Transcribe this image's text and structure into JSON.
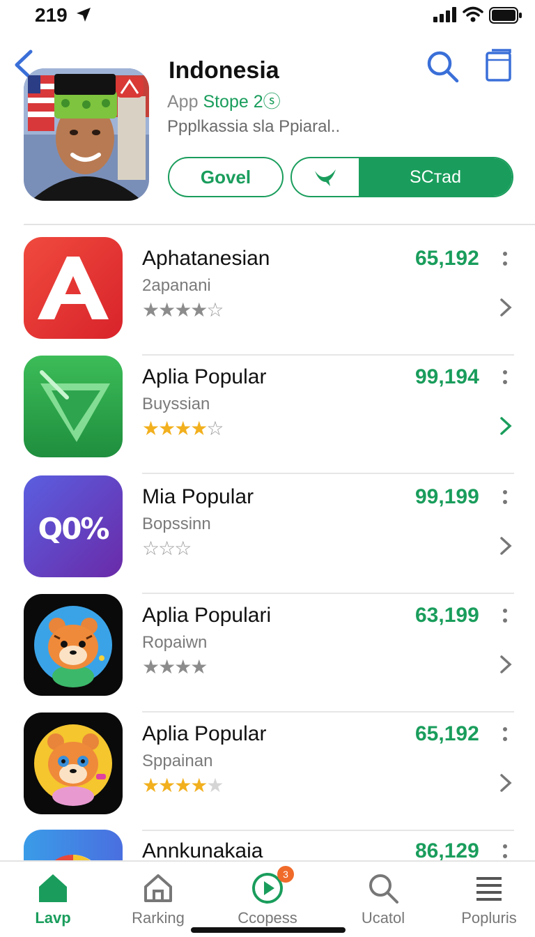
{
  "status_bar": {
    "time": "219"
  },
  "header": {
    "title": "Indonesia",
    "subtitle_prefix": "App ",
    "subtitle_accent": "Stope 2",
    "subtitle_suffix": "ⓢ",
    "description": "Ppplkassia sla Ppiaral..",
    "btn_outline_label": "Govel",
    "btn_action_label": "SCтad"
  },
  "apps": [
    {
      "name": "Aphatanesian",
      "category": "2apanani",
      "count": "65,192",
      "stars": "gray4",
      "icon": "letter-a"
    },
    {
      "name": "Aplia Popular",
      "category": "Buyssian",
      "count": "99,194",
      "stars": "gold3h",
      "icon": "green-arrow"
    },
    {
      "name": "Mia Popular",
      "category": "Bopssinn",
      "count": "99,199",
      "stars": "outline3",
      "icon": "percent",
      "icon_text": "Q0%"
    },
    {
      "name": "Aplia Populari",
      "category": "Ropaiwn",
      "count": "63,199",
      "stars": "gray4solid",
      "icon": "tiger-blue"
    },
    {
      "name": "Aplia Popular",
      "category": "Sppainan",
      "count": "65,192",
      "stars": "gold4",
      "icon": "tiger-yellow"
    },
    {
      "name": "Annkunakaia",
      "category": "",
      "count": "86,129",
      "stars": "",
      "icon": "chart-circle"
    }
  ],
  "tabs": [
    {
      "label": "Lavp",
      "icon": "home-icon",
      "active": true
    },
    {
      "label": "Rarking",
      "icon": "home-outline-icon",
      "active": false
    },
    {
      "label": "Ccopess",
      "icon": "play-circle-icon",
      "active": false,
      "badge": "3"
    },
    {
      "label": "Ucatol",
      "icon": "search-icon",
      "active": false
    },
    {
      "label": "Popluris",
      "icon": "menu-icon",
      "active": false
    }
  ],
  "colors": {
    "accent": "#1a9d5c",
    "link": "#3a6fd8",
    "star": "#f2b01e"
  }
}
